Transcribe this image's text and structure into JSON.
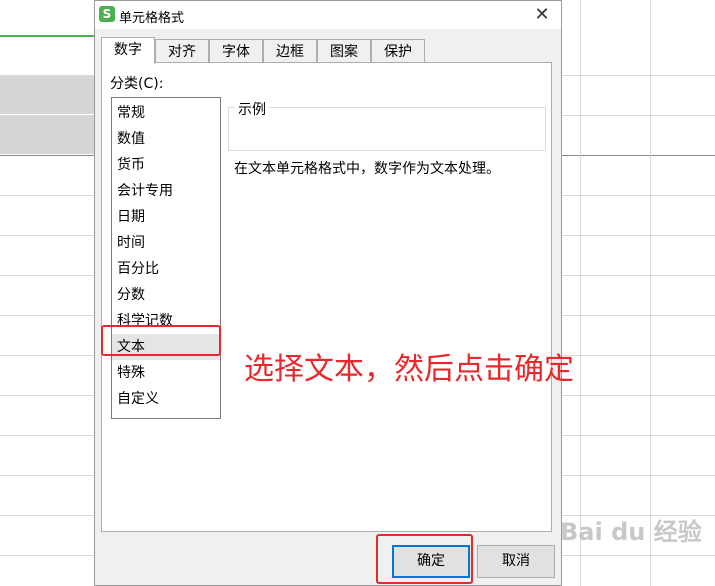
{
  "dialog": {
    "title": "单元格格式",
    "app_icon_letter": "S",
    "close_glyph": "✕"
  },
  "tabs": [
    {
      "label": "数字",
      "active": true
    },
    {
      "label": "对齐",
      "active": false
    },
    {
      "label": "字体",
      "active": false
    },
    {
      "label": "边框",
      "active": false
    },
    {
      "label": "图案",
      "active": false
    },
    {
      "label": "保护",
      "active": false
    }
  ],
  "category": {
    "label": "分类(C):",
    "items": [
      "常规",
      "数值",
      "货币",
      "会计专用",
      "日期",
      "时间",
      "百分比",
      "分数",
      "科学记数",
      "文本",
      "特殊",
      "自定义"
    ],
    "selected": "文本"
  },
  "sample": {
    "label": "示例",
    "value": ""
  },
  "description": "在文本单元格格式中，数字作为文本处理。",
  "buttons": {
    "ok": "确定",
    "cancel": "取消"
  },
  "annotation": "选择文本，然后点击确定",
  "watermark": "Bai du 经验",
  "colors": {
    "annotation_red": "#e8282b",
    "accent_green": "#4caf50",
    "focus_blue": "#0078d7"
  }
}
